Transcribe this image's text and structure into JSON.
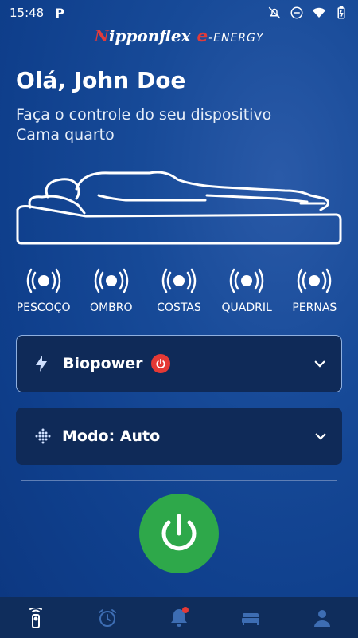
{
  "status": {
    "time": "15:48",
    "app_indicator": "P"
  },
  "logo": {
    "brand1": "ipponflex",
    "brand1_initial": "N",
    "brand2_initial": "e",
    "brand2": "-ENERGY"
  },
  "greeting": "Olá, John Doe",
  "subtitle": {
    "line1": "Faça o controle do seu dispositivo",
    "line2": "Cama quarto"
  },
  "zones": [
    {
      "label": "PESCOÇO",
      "icon": "vibration-icon"
    },
    {
      "label": "OMBRO",
      "icon": "vibration-icon"
    },
    {
      "label": "COSTAS",
      "icon": "vibration-icon"
    },
    {
      "label": "QUADRIL",
      "icon": "vibration-icon"
    },
    {
      "label": "PERNAS",
      "icon": "vibration-icon"
    }
  ],
  "biopower": {
    "label": "Biopower",
    "icon": "lightning-icon",
    "badge": "power-icon",
    "status_color": "#e53935"
  },
  "mode": {
    "label": "Modo: Auto",
    "icon": "dots-wave-icon"
  },
  "power_button": {
    "color": "#2ea84a",
    "icon": "power-icon"
  },
  "nav": [
    {
      "name": "remote",
      "icon": "remote-icon",
      "active": true
    },
    {
      "name": "alarm",
      "icon": "alarm-clock-icon",
      "active": false
    },
    {
      "name": "notifications",
      "icon": "bell-icon",
      "active": false,
      "badge": true
    },
    {
      "name": "bed",
      "icon": "bed-icon",
      "active": false
    },
    {
      "name": "profile",
      "icon": "user-icon",
      "active": false
    }
  ]
}
